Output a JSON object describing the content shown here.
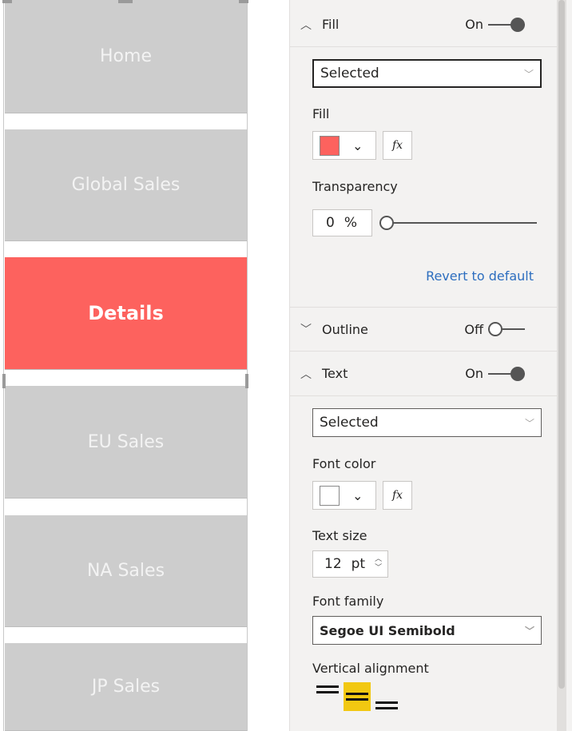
{
  "nav": {
    "buttons": [
      {
        "label": "Home"
      },
      {
        "label": "Global Sales"
      },
      {
        "label": "Details",
        "selected": true
      },
      {
        "label": "EU Sales"
      },
      {
        "label": "NA Sales"
      },
      {
        "label": "JP Sales"
      }
    ],
    "selected_color": "#fd625e",
    "default_color": "#cdcdcd"
  },
  "panel": {
    "fill_section": {
      "title": "Fill",
      "toggle_label": "On",
      "state": "Selected",
      "fill_label": "Fill",
      "fill_color": "#fd625e",
      "fx_label": "fx",
      "transparency_label": "Transparency",
      "transparency_value": "0",
      "transparency_unit": "%",
      "transparency_percent": 0,
      "revert_label": "Revert to default"
    },
    "outline_section": {
      "title": "Outline",
      "toggle_label": "Off"
    },
    "text_section": {
      "title": "Text",
      "toggle_label": "On",
      "state": "Selected",
      "font_color_label": "Font color",
      "font_color": "#ffffff",
      "fx_label": "fx",
      "text_size_label": "Text size",
      "text_size_value": "12",
      "text_size_unit": "pt",
      "font_family_label": "Font family",
      "font_family_value": "Segoe UI Semibold",
      "vertical_alignment_label": "Vertical alignment",
      "vertical_alignment_selected": "middle",
      "highlight_color": "#f2c811"
    }
  }
}
